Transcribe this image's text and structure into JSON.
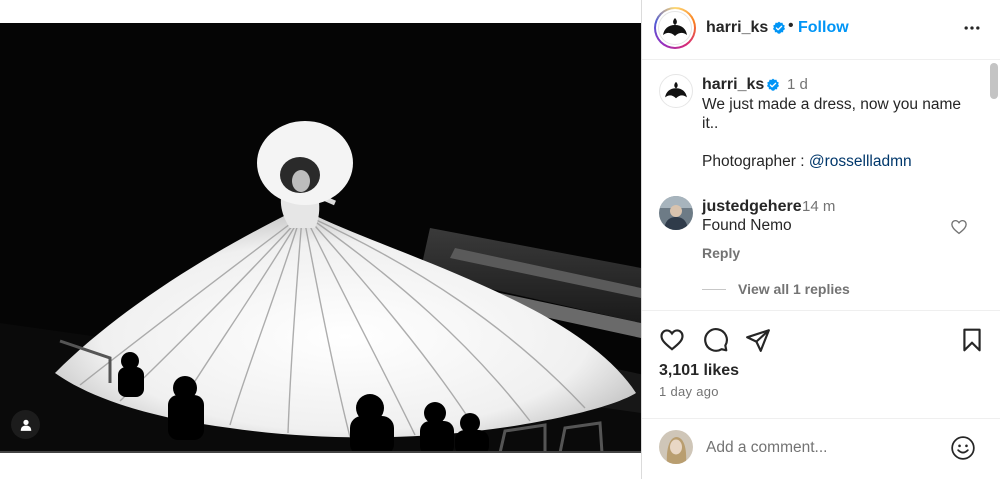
{
  "post": {
    "username": "harri_ks",
    "follow_label": "Follow",
    "separator": "•",
    "caption": {
      "username": "harri_ks",
      "time": "1 d",
      "text": "We just made a dress, now you name it..",
      "credit_prefix": "Photographer : ",
      "credit_link": "@rossellladmn"
    },
    "comment": {
      "username": "justedgehere",
      "time": "14 m",
      "text": "Found Nemo",
      "reply_label": "Reply",
      "view_replies_label": "View all 1 replies"
    },
    "likes": "3,101 likes",
    "date": "1 day ago"
  },
  "add_comment": {
    "placeholder": "Add a comment..."
  },
  "icons": {
    "more": "more-horizontal-icon",
    "like": "heart-icon",
    "comment": "speech-bubble-icon",
    "share": "paper-plane-icon",
    "save": "bookmark-icon",
    "emoji": "smiley-icon",
    "tag": "user-tag-icon",
    "verified": "verified-badge-icon"
  },
  "colors": {
    "accent": "#0095f6",
    "verified": "#0095f6",
    "link": "#00376b",
    "secondary_text": "#737373"
  }
}
